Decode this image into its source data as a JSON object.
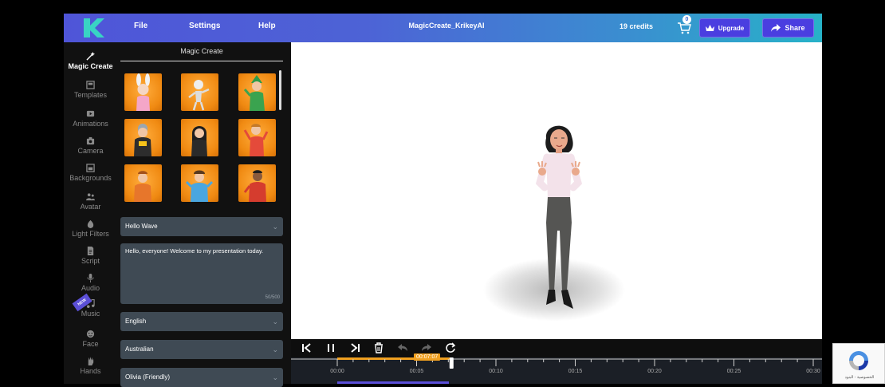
{
  "topbar": {
    "logo_letter": "K",
    "menu": [
      "File",
      "Settings",
      "Help"
    ],
    "title": "MagicCreate_KrikeyAI",
    "credits": "19 credits",
    "cart_count": "0",
    "upgrade_label": "Upgrade",
    "share_label": "Share"
  },
  "sidebar": {
    "items": [
      {
        "label": "Magic Create",
        "icon": "magic-wand-icon",
        "active": true
      },
      {
        "label": "Templates",
        "icon": "templates-icon"
      },
      {
        "label": "Animations",
        "icon": "animations-icon"
      },
      {
        "label": "Camera",
        "icon": "camera-icon"
      },
      {
        "label": "Backgrounds",
        "icon": "backgrounds-icon"
      },
      {
        "label": "Avatar",
        "icon": "avatar-icon"
      },
      {
        "label": "Light Filters",
        "icon": "light-filters-icon"
      },
      {
        "label": "Script",
        "icon": "script-icon"
      },
      {
        "label": "Audio",
        "icon": "microphone-icon"
      },
      {
        "label": "Music",
        "icon": "music-icon",
        "badge": "NEW"
      },
      {
        "label": "Face",
        "icon": "face-icon"
      },
      {
        "label": "Hands",
        "icon": "hands-icon"
      }
    ]
  },
  "panel": {
    "title": "Magic Create",
    "avatars": [
      "bunny-costume-avatar",
      "skeleton-avatar",
      "green-elf-avatar",
      "armored-avatar",
      "dark-hair-avatar",
      "red-shirt-avatar",
      "orange-hoodie-avatar",
      "blue-shirt-avatar",
      "red-jacket-avatar"
    ],
    "animation_select": "Hello Wave",
    "script_text": "Hello, everyone! Welcome to my presentation today.",
    "char_count": "50/500",
    "language_select": "English",
    "accent_select": "Australian",
    "voice_select": "Olivia (Friendly)"
  },
  "timeline": {
    "current_time": "00:07:07",
    "ticks": [
      "00:00",
      "00:05",
      "00:10",
      "00:15",
      "00:20",
      "00:25",
      "00:30"
    ],
    "progress": 0.24
  },
  "recaptcha": {
    "text": "الخصوصية - البنود"
  },
  "colors": {
    "accent": "#4a3ee0",
    "timeline_highlight": "#f0a020",
    "thumb_bg": "#f08a12"
  }
}
